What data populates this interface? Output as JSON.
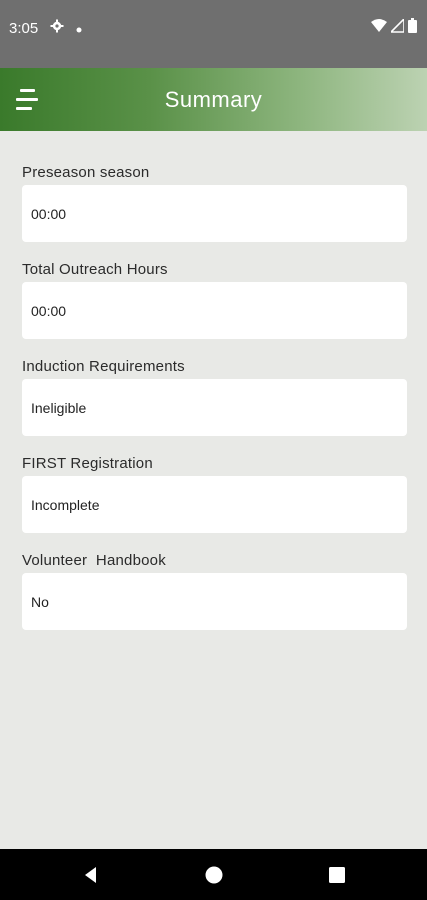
{
  "statusbar": {
    "time": "3:05",
    "icons": [
      "gear-icon",
      "dot-icon",
      "wifi-icon",
      "signal-icon",
      "battery-icon"
    ]
  },
  "appbar": {
    "title": "Summary",
    "menu_icon": "menu-icon",
    "gradient_start": "#3a7a2b",
    "gradient_end": "#bcd2b2"
  },
  "fields": [
    {
      "label": "Preseason season",
      "value": "00:00"
    },
    {
      "label": "Total Outreach Hours",
      "value": "00:00"
    },
    {
      "label": "Induction Requirements",
      "value": "Ineligible"
    },
    {
      "label": "FIRST Registration",
      "value": "Incomplete"
    },
    {
      "label": "Volunteer  Handbook",
      "value": "No"
    }
  ],
  "navbar": {
    "icons": [
      "back-icon",
      "home-icon",
      "recents-icon"
    ]
  }
}
